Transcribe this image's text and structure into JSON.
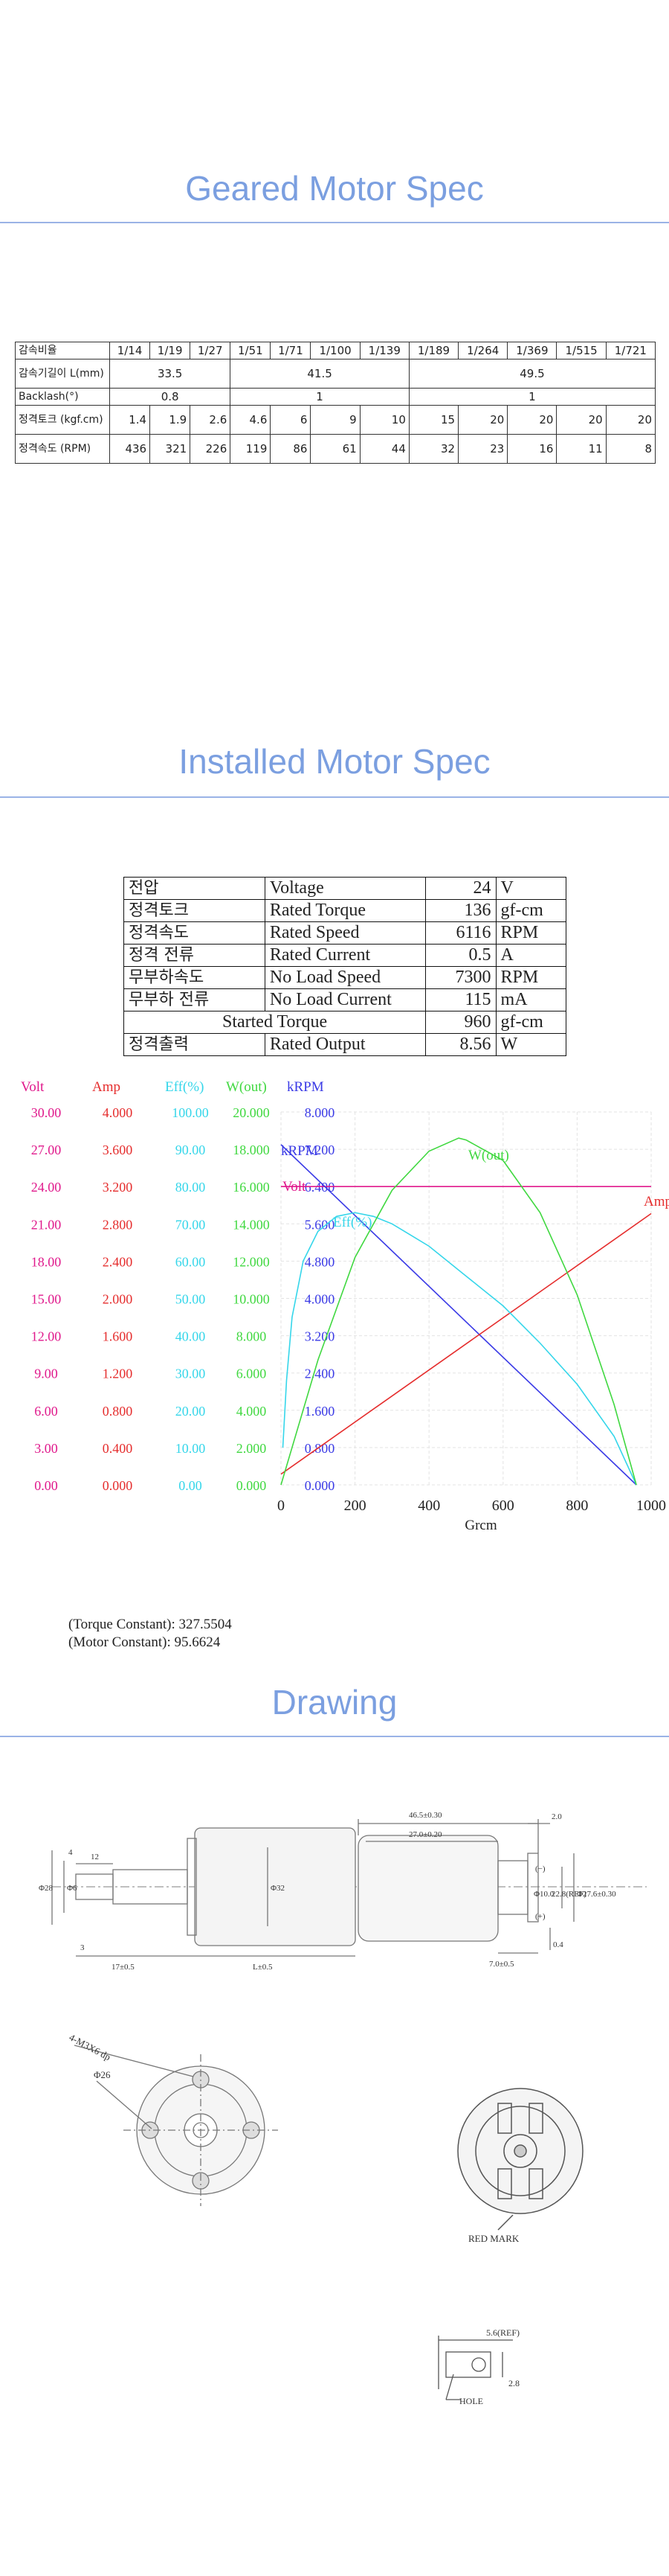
{
  "geared": {
    "title": "Geared Motor Spec",
    "ratio_label": "감속비율",
    "ratios": [
      "1/14",
      "1/19",
      "1/27",
      "1/51",
      "1/71",
      "1/100",
      "1/139",
      "1/189",
      "1/264",
      "1/369",
      "1/515",
      "1/721"
    ],
    "length_label": "감속기길이 L(mm)",
    "lengths": [
      "33.5",
      "41.5",
      "49.5"
    ],
    "backlash_label": "Backlash(°)",
    "backlash": [
      "0.8",
      "1",
      "1"
    ],
    "torque_label": "정격토크 (kgf.cm)",
    "torques": [
      "1.4",
      "1.9",
      "2.6",
      "4.6",
      "6",
      "9",
      "10",
      "15",
      "20",
      "20",
      "20",
      "20"
    ],
    "speed_label": "정격속도 (RPM)",
    "speeds": [
      "436",
      "321",
      "226",
      "119",
      "86",
      "61",
      "44",
      "32",
      "23",
      "16",
      "11",
      "8"
    ]
  },
  "installed": {
    "title": "Installed Motor Spec",
    "rows": [
      {
        "ko": "전압",
        "en": "Voltage",
        "value": "24",
        "unit": "V"
      },
      {
        "ko": "정격토크",
        "en": "Rated Torque",
        "value": "136",
        "unit": "gf-cm"
      },
      {
        "ko": "정격속도",
        "en": "Rated Speed",
        "value": "6116",
        "unit": "RPM"
      },
      {
        "ko": "정격 전류",
        "en": "Rated Current",
        "value": "0.5",
        "unit": "A"
      },
      {
        "ko": "무부하속도",
        "en": "No Load Speed",
        "value": "7300",
        "unit": "RPM"
      },
      {
        "ko": "무부하 전류",
        "en": "No Load Current",
        "value": "115",
        "unit": "mA"
      }
    ],
    "started_label": "Started Torque",
    "started_value": "960",
    "started_unit": "gf-cm",
    "output_ko": "정격출력",
    "output_en": "Rated Output",
    "output_value": "8.56",
    "output_unit": "W"
  },
  "chart_data": {
    "type": "line",
    "xlabel": "Grcm",
    "x_ticks": [
      "0",
      "200",
      "400",
      "600",
      "800",
      "1000"
    ],
    "xlim": [
      0,
      1000
    ],
    "axis_headers": [
      "Volt",
      "Amp",
      "Eff(%)",
      "W(out)",
      "kRPM"
    ],
    "axis_colors": [
      "#e0198c",
      "#e52d2d",
      "#35d6ea",
      "#40d840",
      "#3a3ae6"
    ],
    "tick_columns": [
      [
        "30.00",
        "27.00",
        "24.00",
        "21.00",
        "18.00",
        "15.00",
        "12.00",
        "9.00",
        "6.00",
        "3.00",
        "0.00"
      ],
      [
        "4.000",
        "3.600",
        "3.200",
        "2.800",
        "2.400",
        "2.000",
        "1.600",
        "1.200",
        "0.800",
        "0.400",
        "0.000"
      ],
      [
        "100.00",
        "90.00",
        "80.00",
        "70.00",
        "60.00",
        "50.00",
        "40.00",
        "30.00",
        "20.00",
        "10.00",
        "0.00"
      ],
      [
        "20.000",
        "18.000",
        "16.000",
        "14.000",
        "12.000",
        "10.000",
        "8.000",
        "6.000",
        "4.000",
        "2.000",
        "0.000"
      ],
      [
        "8.000",
        "7.200",
        "6.400",
        "5.600",
        "4.800",
        "4.000",
        "3.200",
        "2.400",
        "1.600",
        "0.800",
        "0.000"
      ]
    ],
    "series": [
      {
        "name": "Volt",
        "color": "#e0198c",
        "x": [
          0,
          1000
        ],
        "y": [
          24,
          24
        ],
        "axis_max": 30
      },
      {
        "name": "kRPM",
        "color": "#3a3ae6",
        "x": [
          0,
          960
        ],
        "y": [
          7.3,
          0
        ],
        "axis_max": 8
      },
      {
        "name": "Amp",
        "color": "#e52d2d",
        "x": [
          0,
          1000
        ],
        "y": [
          0.115,
          2.91
        ],
        "axis_max": 4
      },
      {
        "name": "Eff(%)",
        "color": "#35d6ea",
        "x": [
          5,
          15,
          30,
          60,
          100,
          150,
          200,
          250,
          300,
          350,
          400,
          500,
          600,
          700,
          800,
          900,
          960
        ],
        "y": [
          10,
          28,
          45,
          60,
          68,
          72,
          73,
          72,
          70,
          67,
          64,
          56,
          48,
          38,
          27,
          13,
          0
        ],
        "axis_max": 100
      },
      {
        "name": "W(out)",
        "color": "#40d840",
        "x": [
          0,
          100,
          200,
          300,
          400,
          480,
          500,
          600,
          700,
          800,
          900,
          960
        ],
        "y": [
          0,
          6.7,
          12.2,
          15.8,
          17.9,
          18.6,
          18.5,
          17.4,
          14.6,
          10.2,
          4.3,
          0
        ],
        "axis_max": 20
      }
    ],
    "constants": {
      "torque": "(Torque Constant): 327.5504",
      "motor": "(Motor Constant): 95.6624"
    }
  },
  "drawing": {
    "title": "Drawing",
    "dims": {
      "d1": "46.5±0.30",
      "d2": "27.0±0.20",
      "d3": "2.0",
      "d4": "12",
      "d5": "4",
      "d6": "Φ28",
      "d7": "Φ6",
      "d8": "Φ32",
      "d9": "Φ10.0",
      "d10": "22.8(REF)",
      "d11": "Φ27.6±0.30",
      "d12": "7.0±0.5",
      "d13": "0.4",
      "d14": "3",
      "d15": "17±0.5",
      "d16": "L±0.5",
      "minus": "(−)",
      "plus": "(+)",
      "holes": "4-M3X6 dp",
      "pcd": "Φ26",
      "red_mark": "RED MARK",
      "ref": "5.6(REF)",
      "hole": "HOLE",
      "h28": "2.8"
    }
  }
}
